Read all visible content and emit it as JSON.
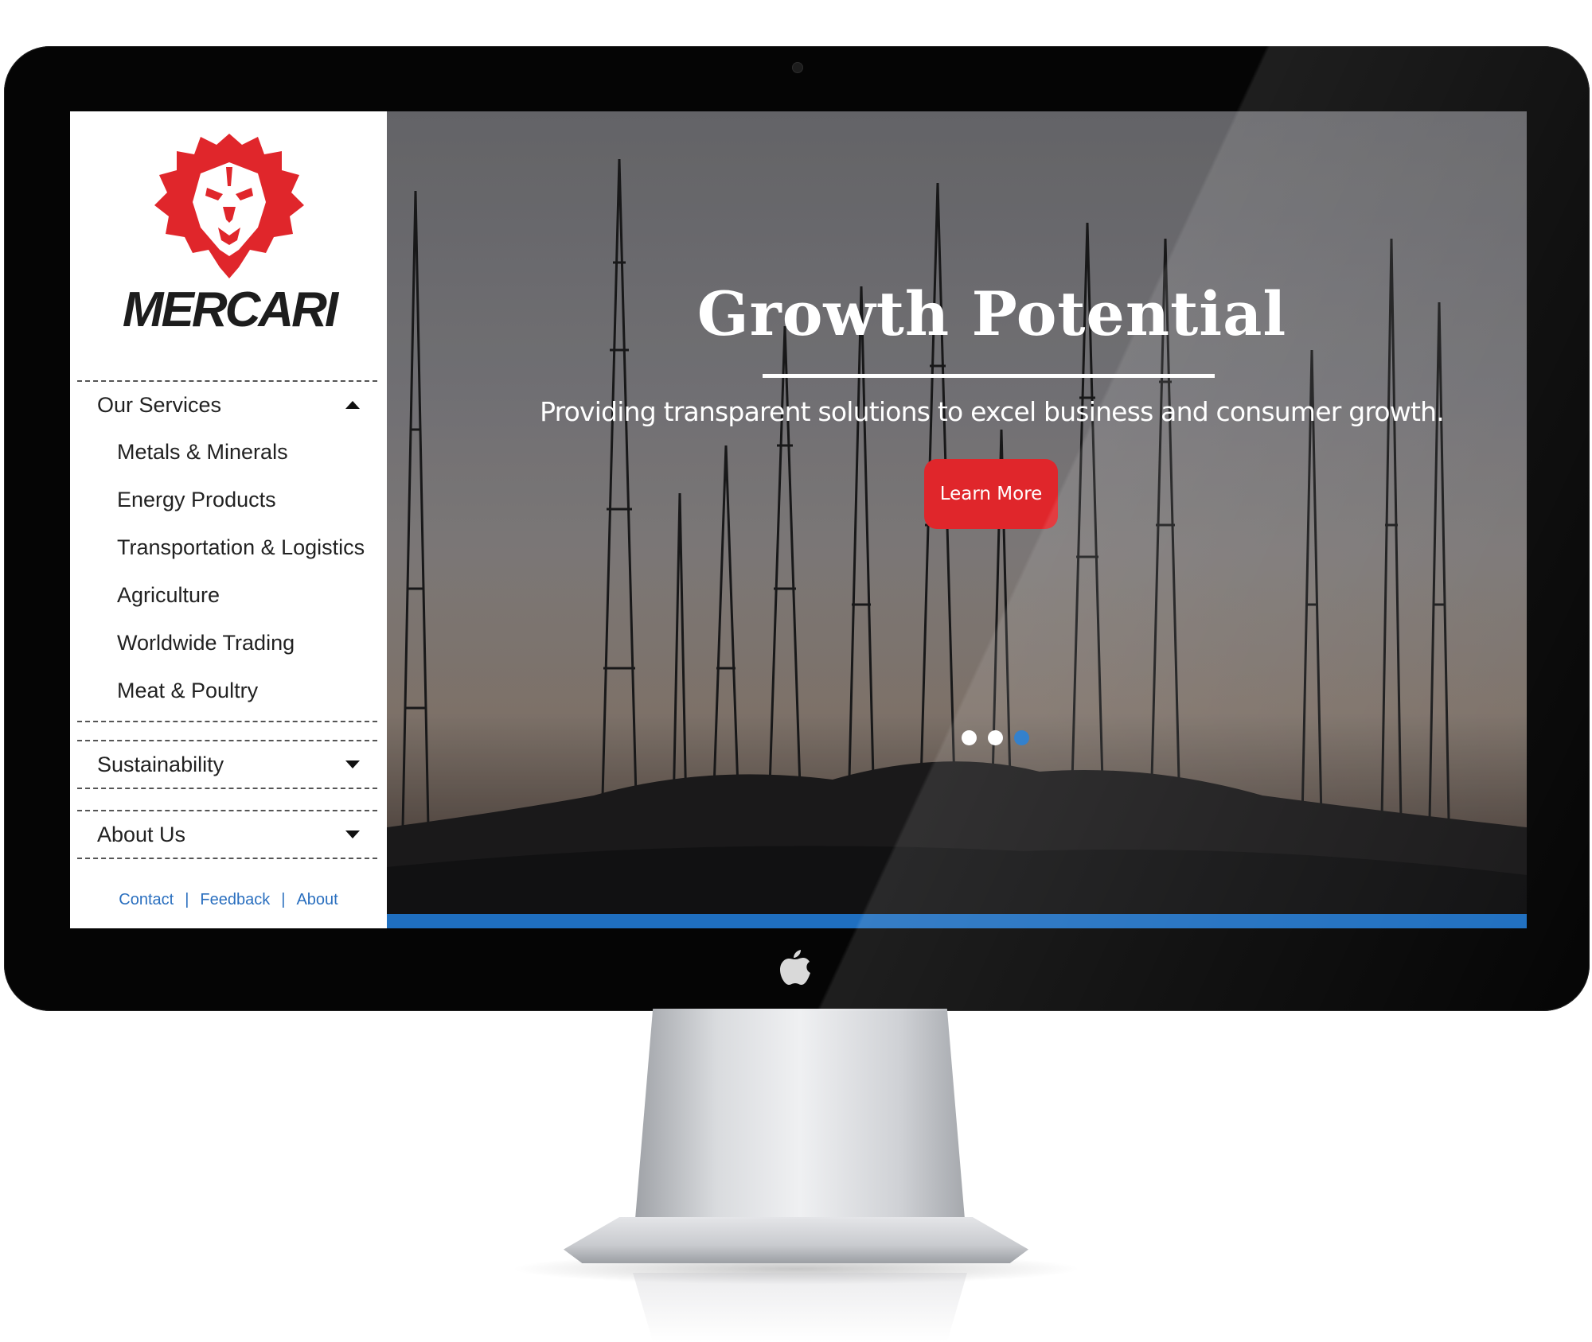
{
  "brand": {
    "name": "MERCARI",
    "logo_icon": "lion-head-icon",
    "accent": "#e0262b"
  },
  "nav": {
    "services": {
      "label": "Our Services",
      "expanded": true,
      "items": [
        {
          "label": "Metals & Minerals"
        },
        {
          "label": "Energy Products"
        },
        {
          "label": "Transportation & Logistics"
        },
        {
          "label": "Agriculture"
        },
        {
          "label": "Worldwide Trading"
        },
        {
          "label": "Meat & Poultry"
        }
      ]
    },
    "sustainability": {
      "label": "Sustainability",
      "expanded": false
    },
    "about": {
      "label": "About Us",
      "expanded": false
    }
  },
  "footer": {
    "links": [
      "Contact",
      "Feedback",
      "About"
    ],
    "separator": "|",
    "color": "#2a6fbf"
  },
  "hero": {
    "title": "Growth Potential",
    "subtitle": "Providing transparent solutions to excel business and consumer growth.",
    "button_label": "Learn More",
    "button_color": "#e0262b",
    "slides_total": 3,
    "active_slide": 3,
    "bar_color": "#1f6fc0"
  }
}
